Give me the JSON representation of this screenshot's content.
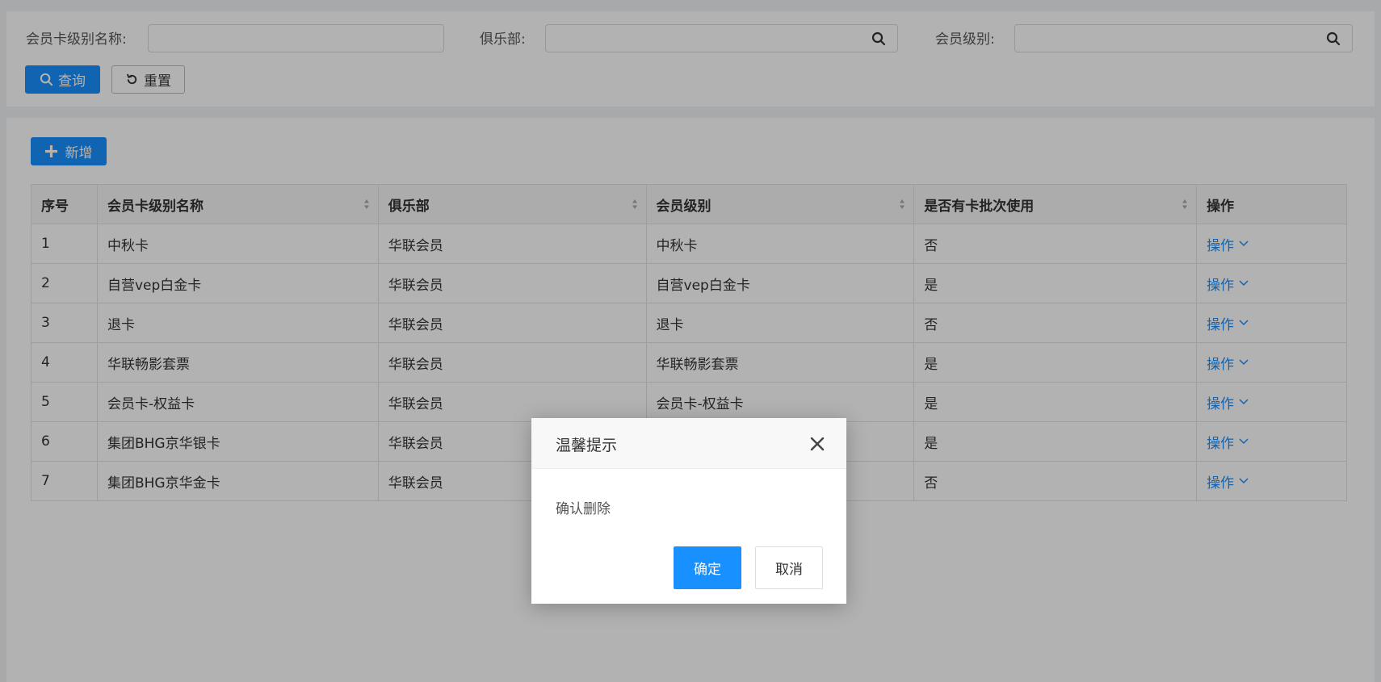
{
  "search": {
    "card_level_name_label": "会员卡级别名称:",
    "club_label": "俱乐部:",
    "member_level_label": "会员级别:",
    "card_level_name_value": "",
    "club_value": "",
    "member_level_value": "",
    "query_label": "查询",
    "reset_label": "重置"
  },
  "toolbar": {
    "add_label": "新增"
  },
  "table": {
    "headers": [
      "序号",
      "会员卡级别名称",
      "俱乐部",
      "会员级别",
      "是否有卡批次使用",
      "操作"
    ],
    "action_label": "操作",
    "rows": [
      [
        "1",
        "中秋卡",
        "华联会员",
        "中秋卡",
        "否"
      ],
      [
        "2",
        "自营vep白金卡",
        "华联会员",
        "自营vep白金卡",
        "是"
      ],
      [
        "3",
        "退卡",
        "华联会员",
        "退卡",
        "否"
      ],
      [
        "4",
        "华联畅影套票",
        "华联会员",
        "华联畅影套票",
        "是"
      ],
      [
        "5",
        "会员卡-权益卡",
        "华联会员",
        "会员卡-权益卡",
        "是"
      ],
      [
        "6",
        "集团BHG京华银卡",
        "华联会员",
        "",
        "是"
      ],
      [
        "7",
        "集团BHG京华金卡",
        "华联会员",
        "",
        "否"
      ]
    ]
  },
  "modal": {
    "title": "温馨提示",
    "message": "确认删除",
    "confirm_label": "确定",
    "cancel_label": "取消"
  },
  "colors": {
    "primary": "#1890ff",
    "mask": "rgba(0,0,0,0.3)"
  },
  "icons": [
    "search-icon",
    "reset-icon",
    "plus-icon",
    "sort-icon",
    "chevron-down-icon",
    "close-icon"
  ]
}
